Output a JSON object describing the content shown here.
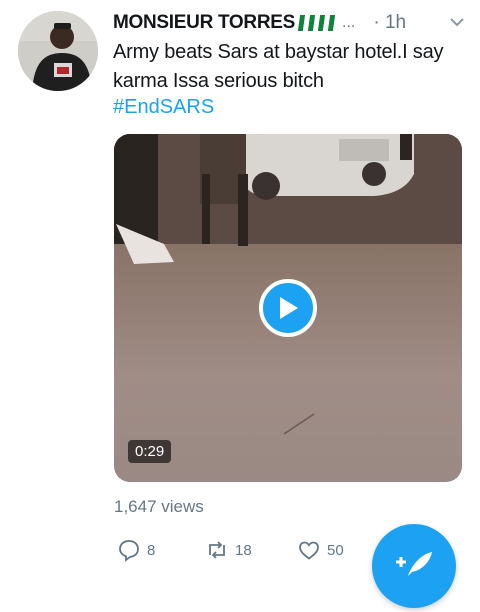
{
  "tweet": {
    "author_name": "MONSIEUR TORRES",
    "ellipsis": "...",
    "time": "· 1h",
    "text": "Army beats Sars at baystar hotel.I say karma Issa serious bitch",
    "hashtag": "#EndSARS"
  },
  "media": {
    "duration": "0:29"
  },
  "stats": {
    "views": "1,647 views",
    "replies": "8",
    "retweets": "18",
    "likes": "50"
  },
  "colors": {
    "accent": "#1da1f2",
    "muted": "#657786",
    "flag_green": "#11823b"
  },
  "icons": {
    "caret": "chevron-down-icon",
    "reply": "reply-icon",
    "retweet": "retweet-icon",
    "like": "heart-icon",
    "compose": "compose-tweet-icon"
  }
}
